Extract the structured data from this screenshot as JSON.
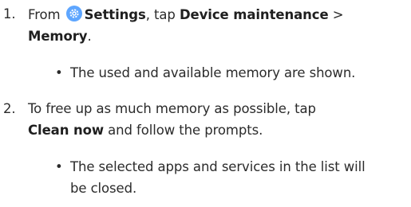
{
  "steps": [
    {
      "number": "1.",
      "text_before": "From",
      "icon": "settings-gear-icon",
      "settings_label": "Settings",
      "text_mid": ", tap",
      "device_maintenance": "Device maintenance",
      "arrow": ">",
      "memory": "Memory",
      "end_period": ".",
      "sub": "The used and available memory are shown."
    },
    {
      "number": "2.",
      "line1": "To free up as much memory as possible, tap",
      "clean_now": "Clean now",
      "line2_rest": "and follow the prompts.",
      "sub_line1": "The selected apps and services in the list will",
      "sub_line2": "be closed."
    }
  ],
  "bullet_char": "•",
  "colors": {
    "text": "#2b2b2b",
    "icon_bg": "#5ea6ff"
  }
}
